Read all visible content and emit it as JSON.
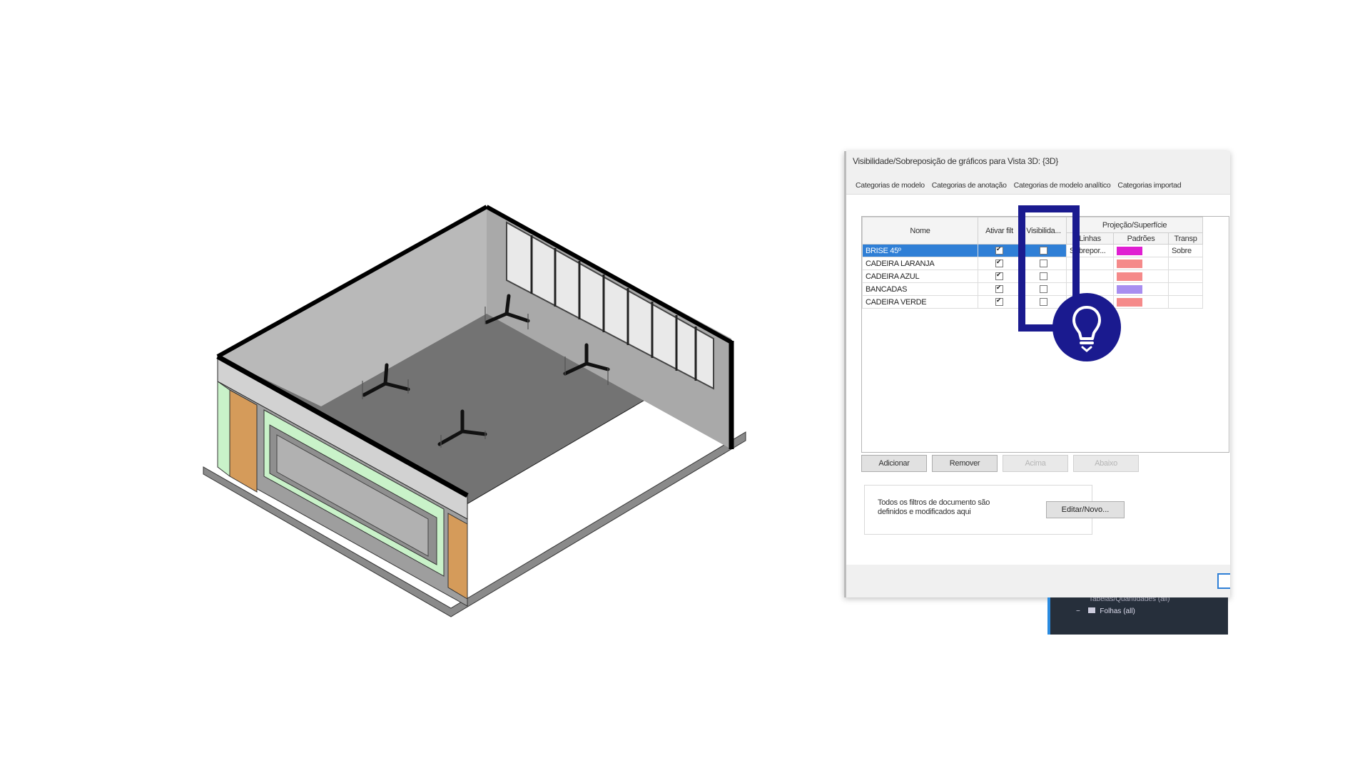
{
  "dialog": {
    "title": "Visibilidade/Sobreposição de gráficos para Vista 3D: {3D}",
    "tabs": [
      "Categorias de modelo",
      "Categorias de anotação",
      "Categorias de modelo analítico",
      "Categorias importad"
    ],
    "headers": {
      "nome": "Nome",
      "ativar": "Ativar filt",
      "visibilidade": "Visibilida...",
      "projecao": "Projeção/Superfície",
      "linhas": "Linhas",
      "padroes": "Padrões",
      "transp": "Transp"
    },
    "rows": [
      {
        "name": "BRISE 45º",
        "active": true,
        "visible": false,
        "lines": "Sobrepor...",
        "pattern": "#e01fd2",
        "transp": "Sobre",
        "selected": true
      },
      {
        "name": "CADEIRA LARANJA",
        "active": true,
        "visible": false,
        "lines": "",
        "pattern": "#f58a8a",
        "transp": "",
        "selected": false
      },
      {
        "name": "CADEIRA AZUL",
        "active": true,
        "visible": false,
        "lines": "",
        "pattern": "#f58a8a",
        "transp": "",
        "selected": false
      },
      {
        "name": "BANCADAS",
        "active": true,
        "visible": false,
        "lines": "",
        "pattern": "#a88ef0",
        "transp": "",
        "selected": false
      },
      {
        "name": "CADEIRA VERDE",
        "active": true,
        "visible": false,
        "lines": "",
        "pattern": "#f58a8a",
        "transp": "",
        "selected": false
      }
    ],
    "buttons": {
      "adicionar": "Adicionar",
      "remover": "Remover",
      "acima": "Acima",
      "abaixo": "Abaixo"
    },
    "filter_note": "Todos os filtros de documento são definidos e modificados aqui",
    "edit_filters": "Editar/Novo..."
  },
  "browser": {
    "row1": "Tabelas/Quantidades (all)",
    "row2": "Folhas (all)"
  },
  "colors": {
    "highlight": "#1a1a8f",
    "selection": "#2f7fd6",
    "door": "#d59b5a",
    "glass": "#c9f2c9"
  },
  "icons": {
    "tip": "lightbulb-icon"
  }
}
